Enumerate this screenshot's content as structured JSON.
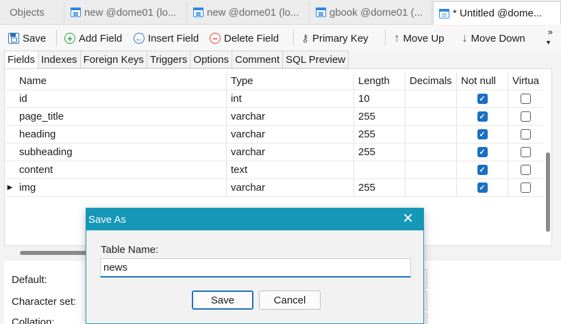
{
  "doc_tabs": [
    {
      "label": "Objects",
      "icon": "none",
      "active": false
    },
    {
      "label": "new @dome01 (lo...",
      "icon": "table-icon",
      "active": false
    },
    {
      "label": "new @dome01 (lo...",
      "icon": "table-icon",
      "active": false
    },
    {
      "label": "gbook @dome01 (...",
      "icon": "table-icon",
      "active": false
    },
    {
      "label": "* Untitled @dome...",
      "icon": "table-icon",
      "active": true
    }
  ],
  "toolbar": {
    "save": "Save",
    "add_field": "Add Field",
    "insert_field": "Insert Field",
    "delete_field": "Delete Field",
    "primary_key": "Primary Key",
    "move_up": "Move Up",
    "move_down": "Move Down",
    "overflow": "»"
  },
  "sub_tabs": [
    "Fields",
    "Indexes",
    "Foreign Keys",
    "Triggers",
    "Options",
    "Comment",
    "SQL Preview"
  ],
  "grid": {
    "columns": [
      "Name",
      "Type",
      "Length",
      "Decimals",
      "Not null",
      "Virtua"
    ],
    "rows": [
      {
        "name": "id",
        "type": "int",
        "length": "10",
        "decimals": "",
        "not_null": true,
        "virtual": false,
        "current": false
      },
      {
        "name": "page_title",
        "type": "varchar",
        "length": "255",
        "decimals": "",
        "not_null": true,
        "virtual": false,
        "current": false
      },
      {
        "name": "heading",
        "type": "varchar",
        "length": "255",
        "decimals": "",
        "not_null": true,
        "virtual": false,
        "current": false
      },
      {
        "name": "subheading",
        "type": "varchar",
        "length": "255",
        "decimals": "",
        "not_null": true,
        "virtual": false,
        "current": false
      },
      {
        "name": "content",
        "type": "text",
        "length": "",
        "decimals": "",
        "not_null": true,
        "virtual": false,
        "current": false
      },
      {
        "name": "img",
        "type": "varchar",
        "length": "255",
        "decimals": "",
        "not_null": true,
        "virtual": false,
        "current": true
      }
    ]
  },
  "properties": {
    "default_label": "Default:",
    "charset_label": "Character set:",
    "collation_label": "Collation:"
  },
  "dialog": {
    "title": "Save As",
    "label": "Table Name:",
    "value": "news",
    "save": "Save",
    "cancel": "Cancel"
  },
  "colors": {
    "dialog_title_bg": "#1597b8",
    "checkbox_on": "#1a6fc4"
  }
}
